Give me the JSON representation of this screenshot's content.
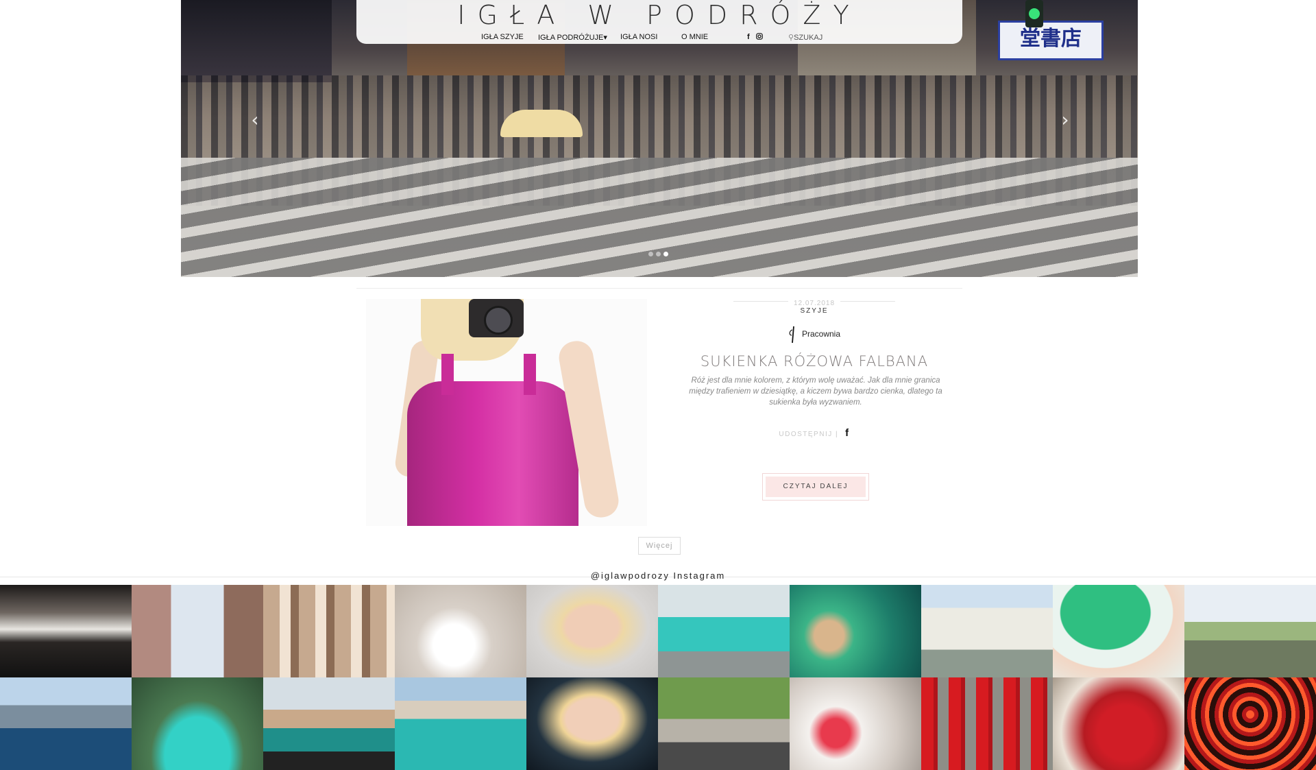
{
  "header": {
    "site_title": "IGŁA W PODRÓŻY",
    "nav": [
      {
        "label": "IGŁA SZYJE"
      },
      {
        "label": "IGŁA PODRÓŻUJE"
      },
      {
        "label": "IGŁA NOSI"
      },
      {
        "label": "O MNIE"
      }
    ],
    "search_label": "SZUKAJ",
    "social_icons": [
      "facebook-icon",
      "instagram-icon"
    ]
  },
  "hero": {
    "sign_text": "堂書店",
    "slide_count": 3,
    "active_slide": 3
  },
  "post": {
    "date": "12.07.2018",
    "category": "SZYJE",
    "author": "Pracownia",
    "title": "SUKIENKA RÓŻOWA FALBANA",
    "excerpt": "Róż jest dla mnie kolorem, z którym wolę uważać. Jak dla mnie granica między trafieniem w dziesiątkę, a kiczem bywa bardzo cienka, dlatego ta sukienka była wyzwaniem.",
    "share_label": "UDOSTĘPNIJ |",
    "read_more": "CZYTAJ DALEJ"
  },
  "more_label": "Więcej",
  "instagram": {
    "title": "@iglawpodrozy Instagram",
    "tile_count": 20
  },
  "colors": {
    "read_more_bg": "#fbe7e6",
    "dress": "#d42fa4",
    "title_gray": "#7f7a7a"
  }
}
